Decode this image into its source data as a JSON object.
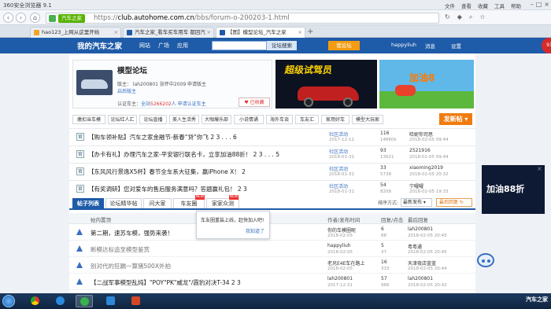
{
  "browser": {
    "title": "360安全浏览器 9.1",
    "menu": [
      "文件",
      "查看",
      "收藏",
      "工具",
      "帮助"
    ],
    "url_badge": "汽车之家",
    "url_prefix": "https://",
    "url_host": "club.autohome.com.cn",
    "url_path": "/bbs/forum-o-200203-1.html",
    "tabs": [
      {
        "label": "hao123_上网从这里开始",
        "active": false
      },
      {
        "label": "汽车之家_看车买车用车 都回汽",
        "active": false
      },
      {
        "label": "【图】模型论坛_汽车之家",
        "active": true
      }
    ]
  },
  "site": {
    "logo": "我的汽车之家",
    "nav": [
      "网站",
      "广场",
      "应用"
    ],
    "search_button": "论坛搜索",
    "post_button": "我论坛",
    "user": "happyliuh",
    "msg": "消息",
    "settings": "设置"
  },
  "forum": {
    "name": "模型论坛",
    "line1": "版主： lah200801  张怀中2009  申请版主",
    "line2": "启后版主",
    "cert_label": "认证车主：",
    "cert_link": "全站",
    "cert_count": "5266202",
    "cert_suffix": "人  申请认证车主",
    "fav": "已收藏"
  },
  "ads": {
    "ad1": "超级试驾员",
    "ad2": "加油8",
    "side": "加油88折"
  },
  "categories": [
    "缴扣当车模",
    "论坛红人汇",
    "论坛直播",
    "美人生活秀",
    "大咖爆乐部",
    "小说情诵",
    "海外车谈",
    "车友汇",
    "家用好车",
    "模型大玩家"
  ],
  "post_big": "发新帖",
  "pinned": [
    {
      "title": "【购车领补贴】汽车之家金融节-新春“贷”你飞 2 3 . . . 6",
      "col": "社区活动",
      "col_date": "2017-12-11",
      "replies": "116",
      "views": "14860k",
      "last": "哈妮你司思",
      "last_date": "2018-02-05 09:44"
    },
    {
      "title": "【办卡有礼】办理汽车之家-平安银行联名卡，立享加油88折！ 2 3 . . . 5",
      "col": "社区活动",
      "col_date": "2018-01-31",
      "replies": "93",
      "views": "13621",
      "last": "2521916",
      "last_date": "2018-02-05 09:44"
    },
    {
      "title": "【东风风行景逸X5杯】春节全车系大征集，赢iPhone X！ 2",
      "col": "社区活动",
      "col_date": "2018-01-31",
      "replies": "33",
      "views": "5738",
      "last": "xiaoming2019",
      "last_date": "2018-02-05 20:32"
    },
    {
      "title": "【有奖调研】您对爱车的售后服务满意吗？答题赢礼包！ 2 3",
      "col": "社区活动",
      "col_date": "2018-01-31",
      "replies": "54",
      "views": "8208",
      "last": "宁曜曜",
      "last_date": "2018-02-05 19:33"
    }
  ],
  "list_tabs": [
    "帖子列表",
    "论坛精华帖",
    "问大家",
    "车友圈",
    "家家众测"
  ],
  "new_badge": "NEW",
  "sort_label": "排序方式:",
  "sort_value": "最新发布",
  "refresh": "最后回复",
  "headers": {
    "title": "帖内置顶",
    "author": "作者/发布时间",
    "reply": "回复/点击",
    "last": "最后回复"
  },
  "tooltip": {
    "text": "车友圈重装上线，赶快加入吧!",
    "link": "我知道了"
  },
  "rows": [
    {
      "title": "第二期，速苏车模，强势来袭！",
      "gray": false,
      "author": "你的车模圈呢",
      "date": "2018-02-05",
      "replies": "6",
      "views": "88",
      "last": "lah200801",
      "last_date": "2018-02-05 20:45"
    },
    {
      "title": "断模达标追至模型鉴赏",
      "gray": true,
      "author": "happyliuh",
      "date": "2018-02-05",
      "replies": "5",
      "views": "37",
      "last": "粤粤通",
      "last_date": "2018-02-05 20:45"
    },
    {
      "title": "别对代的狂踹一算猪500X外拍",
      "gray": true,
      "author": "老兄E4E车在路上",
      "date": "2018-02-05",
      "replies": "16",
      "views": "333",
      "last": "天津夜店蓝蓝",
      "last_date": "2018-02-05 20:44"
    },
    {
      "title": "【二战军事模型乱炖】\"POY\"PK\"威龙\"/霞豹对决T-34 2 3",
      "gray": false,
      "author": "lah200801",
      "date": "2017-12-31",
      "replies": "57",
      "views": "966",
      "last": "lah200801",
      "last_date": "2018-02-05 20:42"
    }
  ],
  "tray": "汽车之家"
}
